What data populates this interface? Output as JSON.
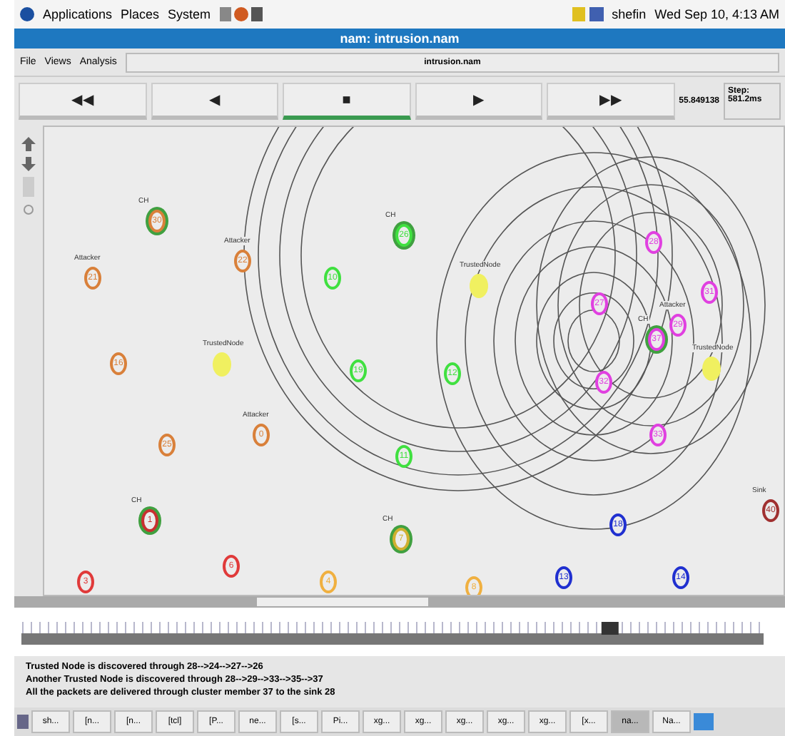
{
  "top_panel": {
    "menus": [
      "Applications",
      "Places",
      "System"
    ],
    "user": "shefin",
    "clock": "Wed Sep 10,  4:13 AM"
  },
  "window": {
    "title": "nam: intrusion.nam"
  },
  "menu": [
    "File",
    "Views",
    "Analysis"
  ],
  "file_field": "intrusion.nam",
  "transport": [
    {
      "label": "◀◀",
      "selected": false
    },
    {
      "label": "◀",
      "selected": false
    },
    {
      "label": "■",
      "selected": true
    },
    {
      "label": "▶",
      "selected": false
    },
    {
      "label": "▶▶",
      "selected": false
    }
  ],
  "time": "55.849138",
  "step": "Step: 581.2ms",
  "nodes": [
    {
      "number": "30",
      "label": "CH",
      "kind": "head",
      "color": "#d9803a"
    },
    {
      "number": "21",
      "label": "Attacker",
      "kind": "plain",
      "color": "#d9803a"
    },
    {
      "number": "22",
      "label": "Attacker",
      "kind": "plain",
      "color": "#d9803a"
    },
    {
      "label": "TrustedNode",
      "kind": "trusted",
      "color": "#f0f060"
    },
    {
      "number": "16",
      "kind": "plain",
      "color": "#d9803a"
    },
    {
      "number": "25",
      "kind": "plain",
      "color": "#d9803a"
    },
    {
      "number": "0",
      "label": "Attacker",
      "kind": "plain",
      "color": "#d9803a"
    },
    {
      "number": "1",
      "label": "CH",
      "kind": "head",
      "color": "#c83030"
    },
    {
      "number": "3",
      "kind": "plain",
      "color": "#e03a3a"
    },
    {
      "number": "6",
      "kind": "plain",
      "color": "#e03a3a"
    },
    {
      "number": "4",
      "kind": "plain",
      "color": "#f0b040"
    },
    {
      "number": "7",
      "label": "CH",
      "kind": "head",
      "color": "#d0b030"
    },
    {
      "number": "8",
      "kind": "plain",
      "color": "#f0b040"
    },
    {
      "number": "13",
      "kind": "plain",
      "color": "#2030d0"
    },
    {
      "number": "14",
      "kind": "plain",
      "color": "#2030d0"
    },
    {
      "number": "18",
      "kind": "plain",
      "color": "#2030d0"
    },
    {
      "number": "40",
      "label": "Sink",
      "kind": "plain",
      "color": "#a03030"
    },
    {
      "number": "10",
      "kind": "plain",
      "color": "#40e040"
    },
    {
      "number": "26",
      "label": "CH",
      "kind": "head",
      "color": "#40e040"
    },
    {
      "number": "19",
      "kind": "plain",
      "color": "#40e040"
    },
    {
      "number": "12",
      "kind": "plain",
      "color": "#40e040"
    },
    {
      "number": "11",
      "kind": "plain",
      "color": "#40e040"
    },
    {
      "label": "TrustedNode",
      "kind": "trusted",
      "color": "#f0f060"
    },
    {
      "number": "27",
      "kind": "plain",
      "color": "#e040e0"
    },
    {
      "number": "28",
      "kind": "plain",
      "color": "#e040e0"
    },
    {
      "number": "29",
      "label": "Attacker",
      "kind": "plain",
      "color": "#e040e0"
    },
    {
      "label": "TrustedNode",
      "kind": "trusted",
      "color": "#f0f060"
    },
    {
      "number": "37",
      "label": "CH",
      "kind": "head",
      "color": "#e040e0"
    },
    {
      "number": "31",
      "kind": "plain",
      "color": "#e040e0"
    },
    {
      "number": "32",
      "kind": "plain",
      "color": "#e040e0"
    },
    {
      "number": "33",
      "kind": "plain",
      "color": "#e040e0"
    }
  ],
  "timeline": {
    "level": 0.8
  },
  "log": [
    "Trusted Node is discovered through 28-->24-->27-->26",
    "Another Trusted Node is discovered through 28-->29-->33-->35-->37",
    "All the packets are delivered through cluster member 37 to the sink 28"
  ],
  "taskbar": [
    {
      "label": "sh...",
      "selected": false
    },
    {
      "label": "[n...",
      "selected": false
    },
    {
      "label": "[n...",
      "selected": false
    },
    {
      "label": "[tcl]",
      "selected": false
    },
    {
      "label": "[P...",
      "selected": false
    },
    {
      "label": "ne...",
      "selected": false
    },
    {
      "label": "[s...",
      "selected": false
    },
    {
      "label": "Pi...",
      "selected": false
    },
    {
      "label": "xg...",
      "selected": false
    },
    {
      "label": "xg...",
      "selected": false
    },
    {
      "label": "xg...",
      "selected": false
    },
    {
      "label": "xg...",
      "selected": false
    },
    {
      "label": "xg...",
      "selected": false
    },
    {
      "label": "[x...",
      "selected": false
    },
    {
      "label": "na...",
      "selected": true
    },
    {
      "label": "Na...",
      "selected": false
    }
  ]
}
